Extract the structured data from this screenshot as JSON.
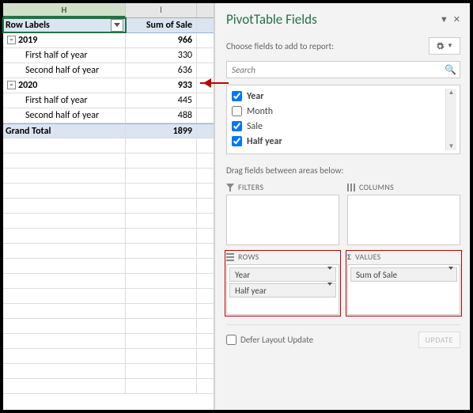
{
  "columns": {
    "H": "H",
    "I": "I"
  },
  "pivot": {
    "header": {
      "rowLabels": "Row Labels",
      "sumOfSale": "Sum of Sale"
    },
    "rows": [
      {
        "label": "2019",
        "val": "966",
        "lvl": 1,
        "toggle": true
      },
      {
        "label": "First half of year",
        "val": "330",
        "lvl": 2
      },
      {
        "label": "Second half of year",
        "val": "636",
        "lvl": 2
      },
      {
        "label": "2020",
        "val": "933",
        "lvl": 1,
        "toggle": true
      },
      {
        "label": "First half of year",
        "val": "445",
        "lvl": 2
      },
      {
        "label": "Second half of year",
        "val": "488",
        "lvl": 2
      }
    ],
    "total": {
      "label": "Grand Total",
      "val": "1899"
    }
  },
  "pane": {
    "title": "PivotTable Fields",
    "subtitle": "Choose fields to add to report:",
    "searchPlaceholder": "Search",
    "fields": [
      {
        "label": "Year",
        "checked": true,
        "bold": true
      },
      {
        "label": "Month",
        "checked": false,
        "bold": false
      },
      {
        "label": "Sale",
        "checked": true,
        "bold": false
      },
      {
        "label": "Half year",
        "checked": true,
        "bold": true
      }
    ],
    "dragText": "Drag fields between areas below:",
    "areas": {
      "filters": "FILTERS",
      "columns": "COLUMNS",
      "rows": "ROWS",
      "values": "VALUES"
    },
    "rowsBox": [
      "Year",
      "Half year"
    ],
    "valuesBox": [
      "Sum of Sale"
    ],
    "deferLabel": "Defer Layout Update",
    "updateLabel": "UPDATE"
  }
}
